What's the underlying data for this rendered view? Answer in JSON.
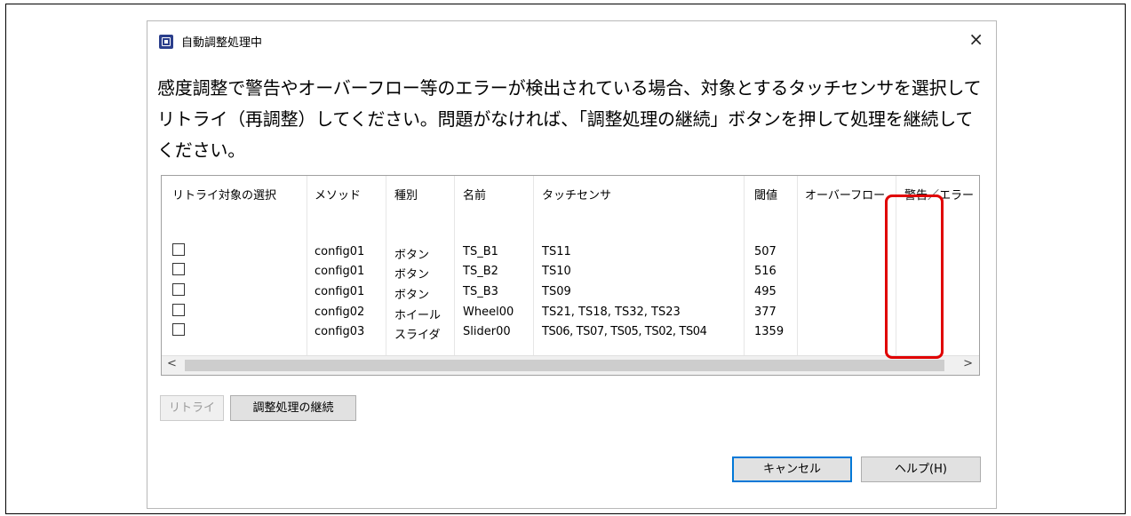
{
  "dialog": {
    "title": "自動調整処理中",
    "close_glyph": "×",
    "description": "感度調整で警告やオーバーフロー等のエラーが検出されている場合、対象とするタッチセンサを選択してリトライ（再調整）してください。問題がなければ、「調整処理の継続」ボタンを押して処理を継続してください。"
  },
  "table": {
    "headers": [
      "リトライ対象の選択",
      "メソッド",
      "種別",
      "名前",
      "タッチセンサ",
      "閾値",
      "オーバーフロー",
      "警告／エラー"
    ],
    "rows": [
      {
        "method": "config01",
        "type": "ボタン",
        "name": "TS_B1",
        "sensor": "TS11",
        "threshold": "507"
      },
      {
        "method": "config01",
        "type": "ボタン",
        "name": "TS_B2",
        "sensor": "TS10",
        "threshold": "516"
      },
      {
        "method": "config01",
        "type": "ボタン",
        "name": "TS_B3",
        "sensor": "TS09",
        "threshold": "495"
      },
      {
        "method": "config02",
        "type": "ホイール",
        "name": "Wheel00",
        "sensor": "TS21, TS18, TS32, TS23",
        "threshold": "377"
      },
      {
        "method": "config03",
        "type": "スライダ",
        "name": "Slider00",
        "sensor": "TS06, TS07, TS05, TS02, TS04",
        "threshold": "1359"
      }
    ],
    "scroll_left_glyph": "<",
    "scroll_right_glyph": ">"
  },
  "buttons": {
    "retry": "リトライ",
    "continue": "調整処理の継続",
    "cancel": "キャンセル",
    "help": "ヘルプ(H)"
  },
  "colors": {
    "highlight": "#e00000",
    "title_icon": "#2b3f8c",
    "default_button_border": "#0078d7"
  }
}
